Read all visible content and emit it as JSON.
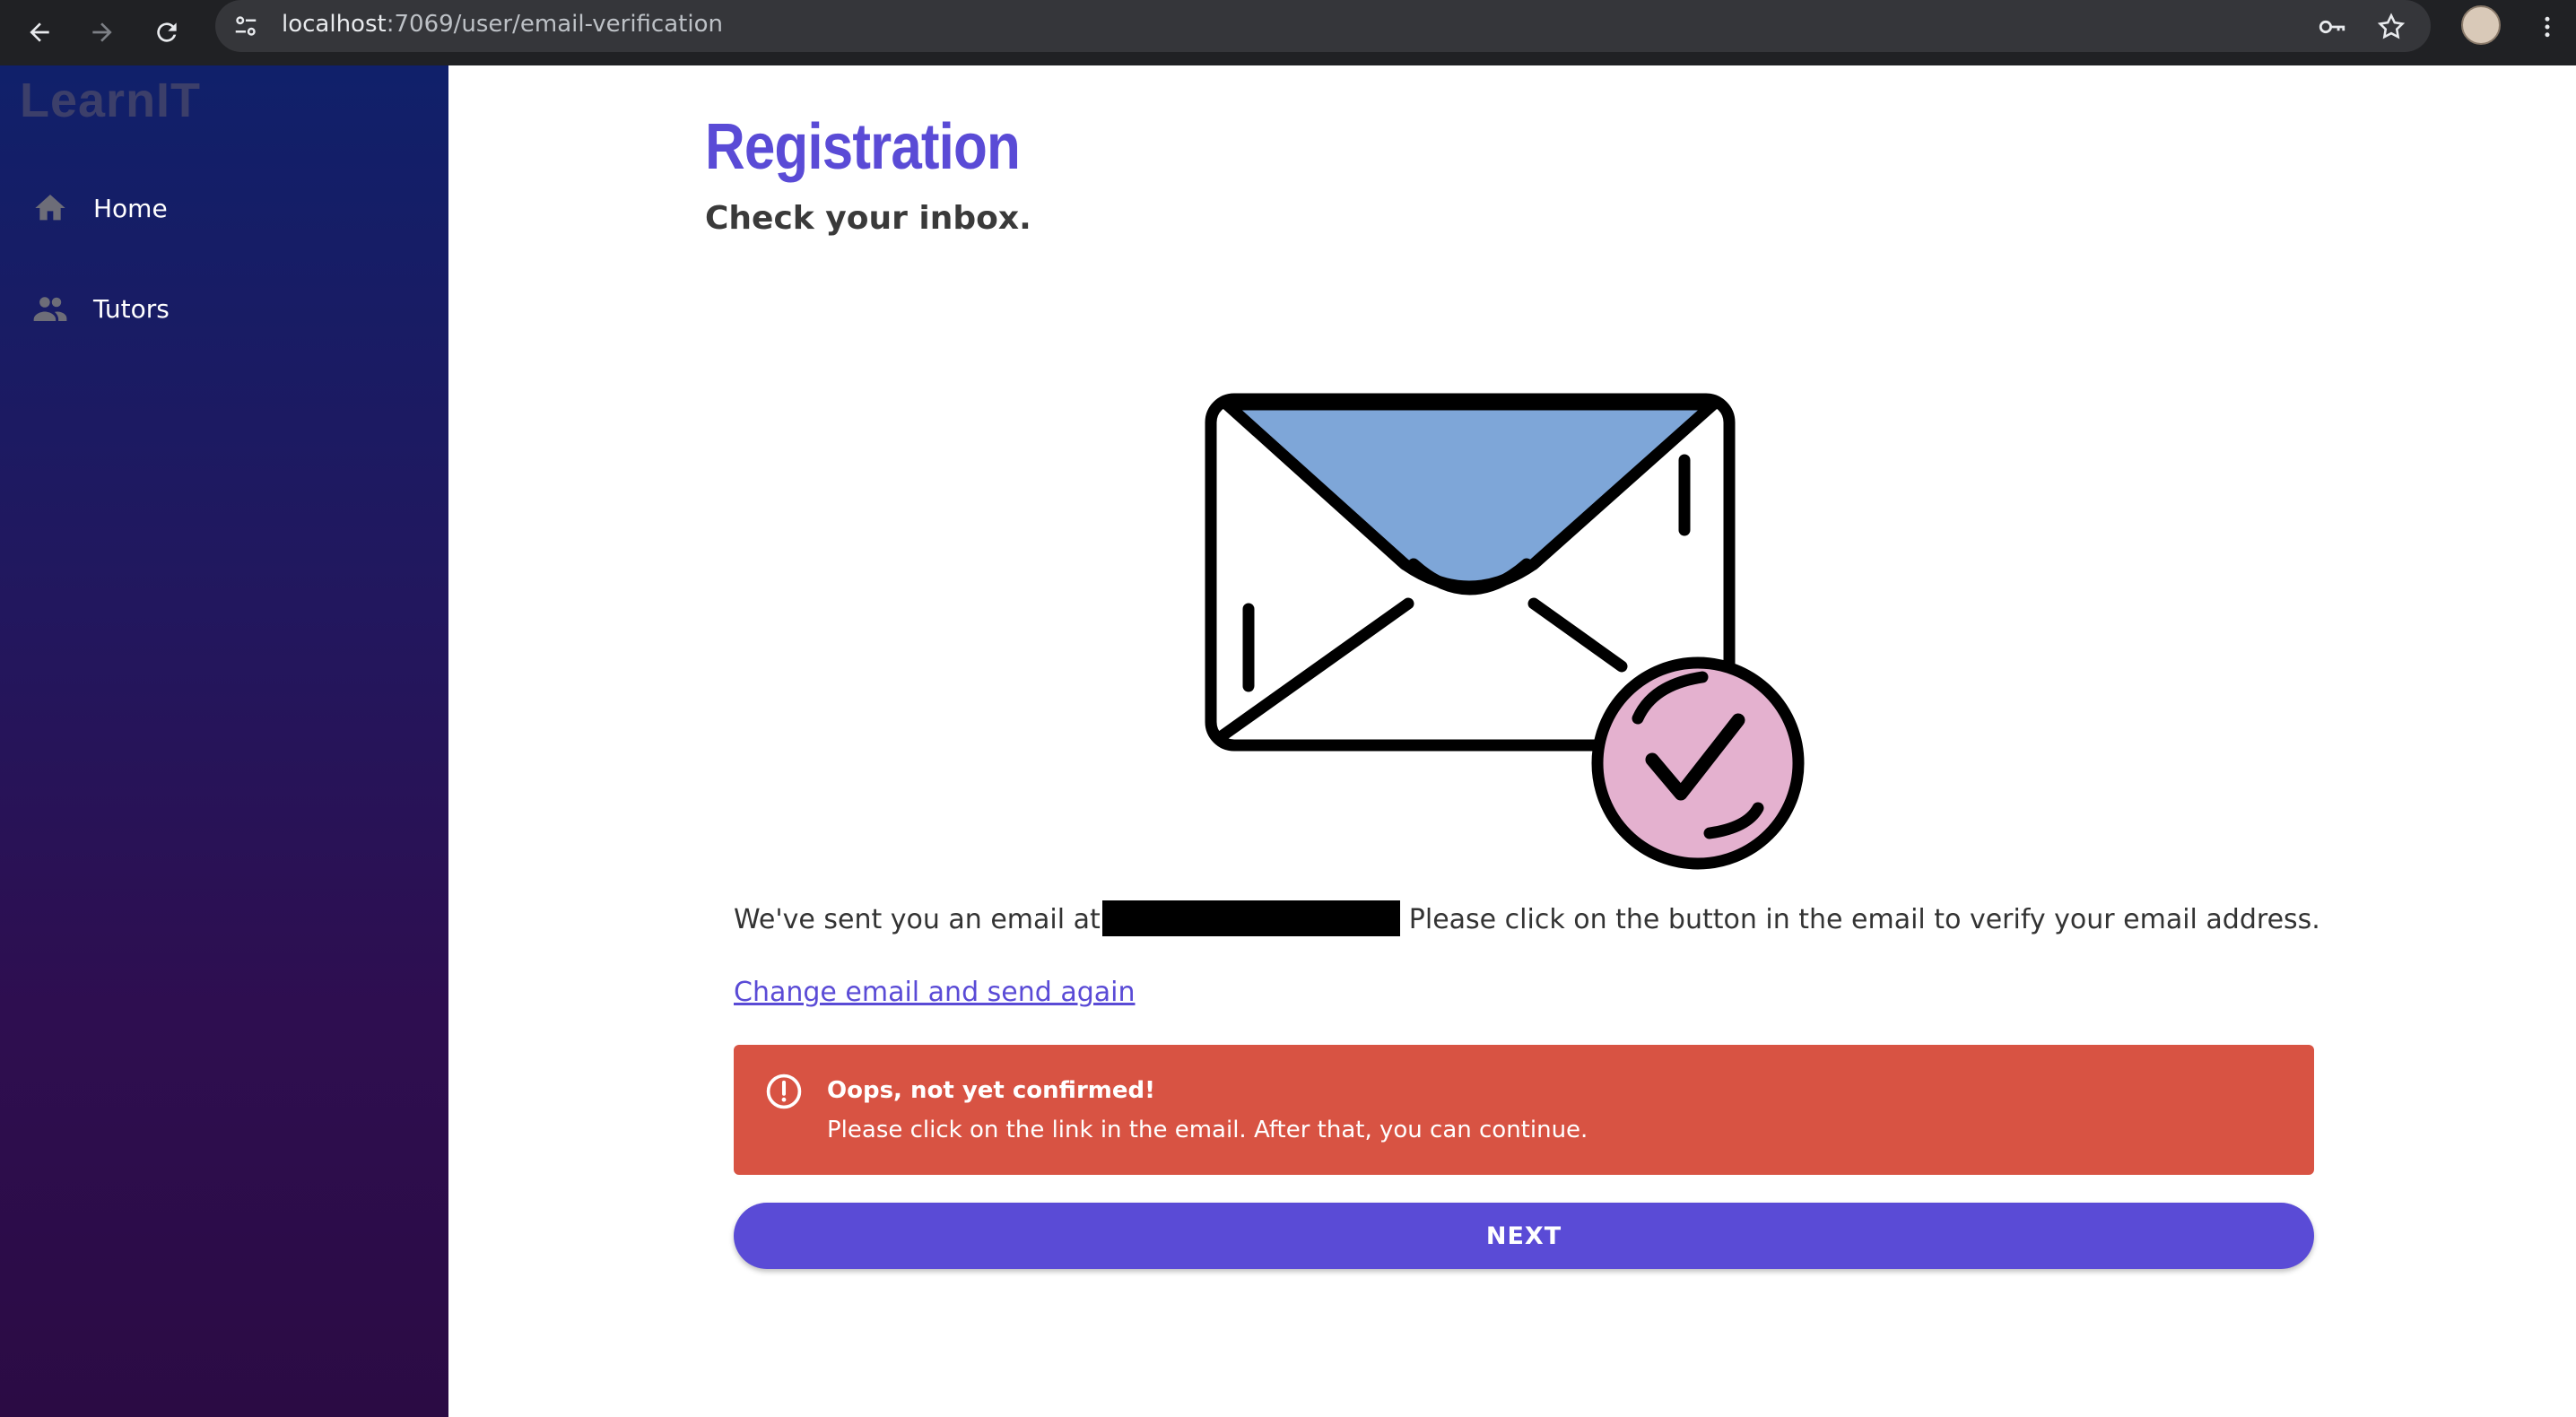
{
  "browser": {
    "url_host": "localhost",
    "url_rest": ":7069/user/email-verification"
  },
  "sidebar": {
    "brand": "LearnIT",
    "items": [
      {
        "label": "Home",
        "icon": "home-icon"
      },
      {
        "label": "Tutors",
        "icon": "people-icon"
      }
    ]
  },
  "main": {
    "title": "Registration",
    "subtitle": "Check your inbox.",
    "message_before": "We've sent you an email at",
    "message_after": "Please click on the button in the email to verify your email address.",
    "change_link": "Change email and send again",
    "alert": {
      "title": "Oops, not yet confirmed!",
      "text": "Please click on the link in the email. After that, you can continue."
    },
    "next_label": "NEXT"
  },
  "colors": {
    "accent": "#5a4bd6",
    "alert_bg": "#d85343",
    "envelope_flap": "#7ea6d8",
    "check_circle": "#e4b1cf"
  }
}
